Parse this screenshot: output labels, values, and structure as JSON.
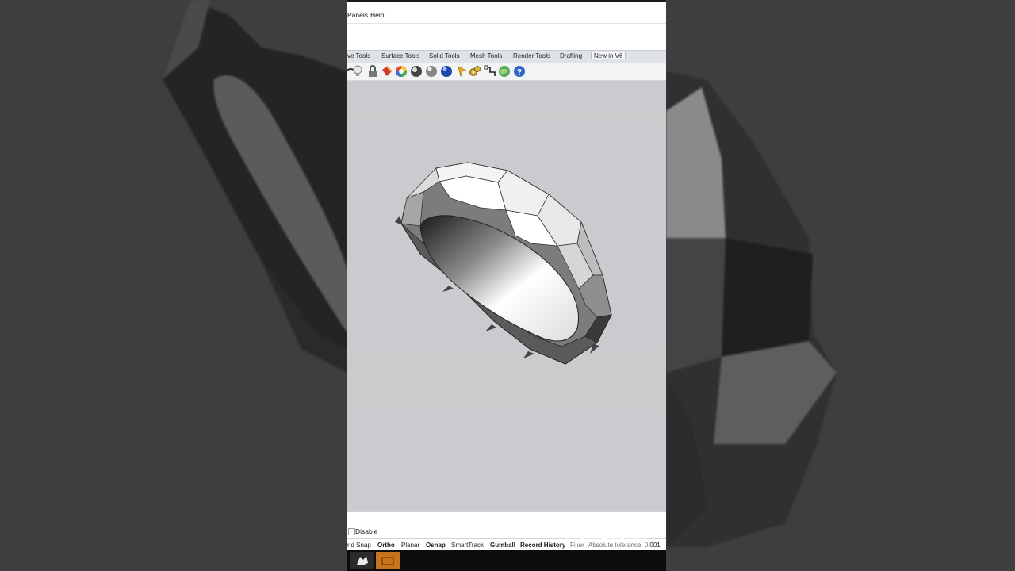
{
  "menu": {
    "items": [
      "Panels",
      "Help"
    ]
  },
  "toolbar_tabs": [
    {
      "label": "ve Tools",
      "active": false
    },
    {
      "label": "Surface Tools",
      "active": false
    },
    {
      "label": "Solid Tools",
      "active": false
    },
    {
      "label": "Mesh Tools",
      "active": false
    },
    {
      "label": "Render Tools",
      "active": false
    },
    {
      "label": "Drafting",
      "active": false
    },
    {
      "label": "New in V6",
      "active": true
    }
  ],
  "toolbar_icons": [
    "curve-tool-icon",
    "light-bulb-icon",
    "lock-icon",
    "paint-bucket-icon",
    "color-wheel-icon",
    "shaded-sphere-icon",
    "material-sphere-icon",
    "blue-sphere-icon",
    "pointer-arrow-icon",
    "gears-icon",
    "grid-align-icon",
    "globe-icon",
    "help-icon"
  ],
  "osnap": {
    "disable_label": "Disable"
  },
  "statusbar": {
    "grid_snap": "rid Snap",
    "ortho": "Ortho",
    "planar": "Planar",
    "osnap": "Osnap",
    "smarttrack": "SmartTrack",
    "gumball": "Gumball",
    "record_history": "Record History",
    "filter": "Filter",
    "tolerance": "Absolute tolerance: 0.001"
  },
  "watermark": {
    "text": "EasyCut"
  },
  "colors": {
    "tab_bar": "#dfe3e8",
    "viewport": "#c9cbce",
    "taskbar": "#0c0c0c",
    "task_orange": "#c8741c"
  }
}
